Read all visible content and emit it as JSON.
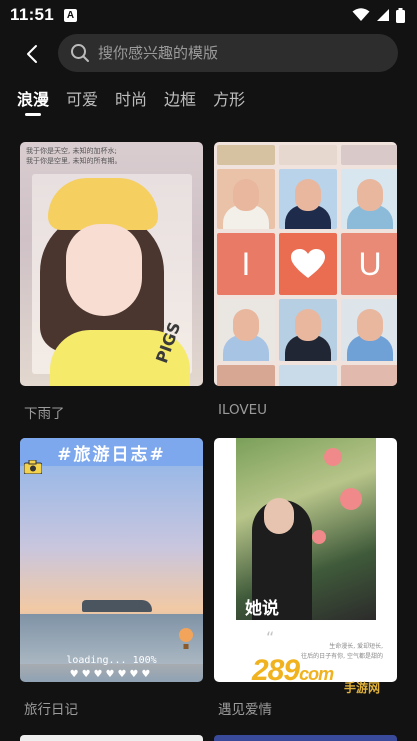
{
  "status_bar": {
    "time": "11:51",
    "notification_icon_letter": "A",
    "icons": [
      "wifi-icon",
      "cell-signal-icon",
      "battery-icon"
    ]
  },
  "search": {
    "placeholder": "搜你感兴趣的模版",
    "back_icon": "chevron-left-icon",
    "search_icon": "search-icon"
  },
  "tabs": [
    {
      "label": "浪漫",
      "active": true
    },
    {
      "label": "可爱",
      "active": false
    },
    {
      "label": "时尚",
      "active": false
    },
    {
      "label": "边框",
      "active": false
    },
    {
      "label": "方形",
      "active": false
    }
  ],
  "templates": [
    {
      "title": "下雨了",
      "overlay_text": [
        "我于你是天空, 未知的加杯水;",
        "我于你是空里, 未知的所有期。"
      ],
      "shirt_text": "PIGS"
    },
    {
      "title": "ILOVEU",
      "letters": [
        "I",
        "U"
      ]
    },
    {
      "title": "旅行日记",
      "banner": "#旅游日志#",
      "loading_text": "loading... 100%",
      "hearts": "♥♥♥♥♥♥♥"
    },
    {
      "title": "遇见爱情",
      "caption": "她说",
      "quote_mark": "“",
      "verse": [
        "生命漫长, 爱却短长,",
        "往后的日子有你, 空气都是甜的"
      ]
    }
  ],
  "watermark": {
    "brand": "289",
    "suffix": "com",
    "sub": "手游网"
  },
  "colors": {
    "background": "#121212",
    "search_bg": "#2d2d2d",
    "tab_inactive": "#bdbdbd",
    "card_title": "#9b9b9b",
    "watermark": "#f0b21e"
  }
}
